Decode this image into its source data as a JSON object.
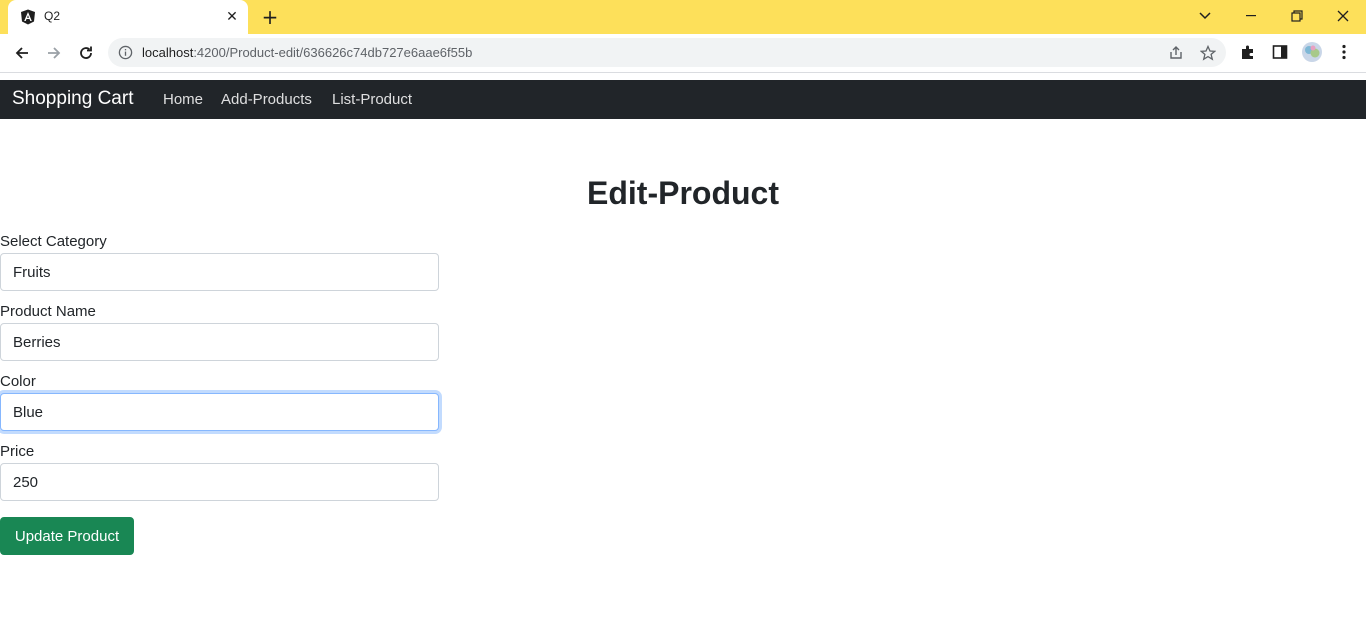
{
  "browser": {
    "tab_title": "Q2",
    "url_host": "localhost",
    "url_path": ":4200/Product-edit/636626c74db727e6aae6f55b"
  },
  "navbar": {
    "brand": "Shopping Cart",
    "links": [
      "Home",
      "Add-Products",
      "List-Product"
    ]
  },
  "page": {
    "title": "Edit-Product"
  },
  "form": {
    "category": {
      "label": "Select Category",
      "value": "Fruits"
    },
    "name": {
      "label": "Product Name",
      "value": "Berries"
    },
    "color": {
      "label": "Color",
      "value": "Blue"
    },
    "price": {
      "label": "Price",
      "value": "250"
    },
    "submit_label": "Update Product"
  },
  "colors": {
    "tabbar": "#fde05a",
    "navbar": "#212529",
    "button": "#198754",
    "focus": "#86b7fe"
  }
}
